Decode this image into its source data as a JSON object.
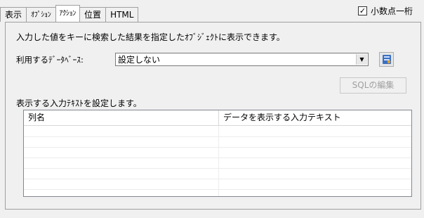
{
  "tabs": [
    {
      "label": "表示"
    },
    {
      "label": "ｵﾌﾟｼｮﾝ"
    },
    {
      "label": "ｱｸｼｮﾝ"
    },
    {
      "label": "位置"
    },
    {
      "label": "HTML"
    }
  ],
  "decimal_checkbox": {
    "checked": true,
    "mark": "✓",
    "label": "小数点一桁"
  },
  "description": "入力した値をキーに検索した結果を指定したｵﾌﾞｼﾞｪｸﾄに表示できます。",
  "database": {
    "label": "利用するﾃﾞｰﾀﾍﾞｰｽ:",
    "selected": "設定しない",
    "dropdown_icon": "▼",
    "button_icon": "database-settings-icon"
  },
  "sql_button": {
    "label": "SQLの編集",
    "enabled": false
  },
  "table": {
    "label": "表示する入力ﾃｷｽﾄを設定します。",
    "columns": [
      "列名",
      "データを表示する入力テキスト"
    ],
    "rows": []
  }
}
